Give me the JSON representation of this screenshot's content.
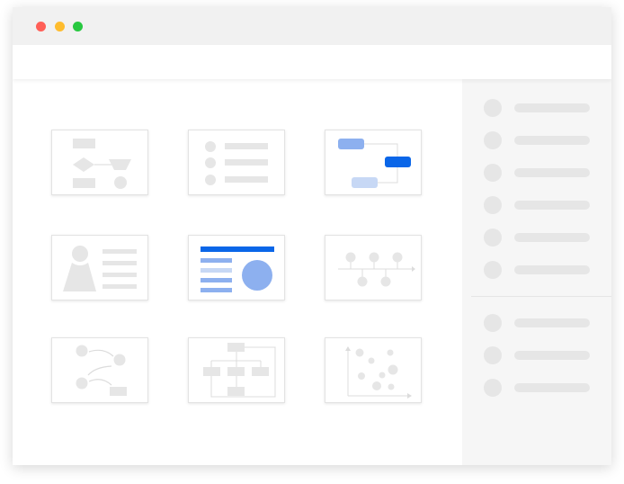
{
  "window": {
    "traffic_lights": [
      {
        "name": "close",
        "color": "#ff5f57"
      },
      {
        "name": "minimize",
        "color": "#febc2e"
      },
      {
        "name": "zoom",
        "color": "#28c840"
      }
    ]
  },
  "colors": {
    "placeholder": "#e6e6e6",
    "accent": "#0a66e8",
    "accent_mid": "#8db0ef",
    "accent_light": "#c7d8f5"
  },
  "templates": [
    {
      "icon": "flowchart-icon"
    },
    {
      "icon": "bullet-list-icon"
    },
    {
      "icon": "connected-blocks-icon"
    },
    {
      "icon": "profile-card-icon"
    },
    {
      "icon": "report-pie-icon"
    },
    {
      "icon": "timeline-icon"
    },
    {
      "icon": "process-flow-icon"
    },
    {
      "icon": "org-chart-icon"
    },
    {
      "icon": "scatter-plot-icon"
    }
  ],
  "sidebar": {
    "group_1_count": 6,
    "group_2_count": 3
  }
}
